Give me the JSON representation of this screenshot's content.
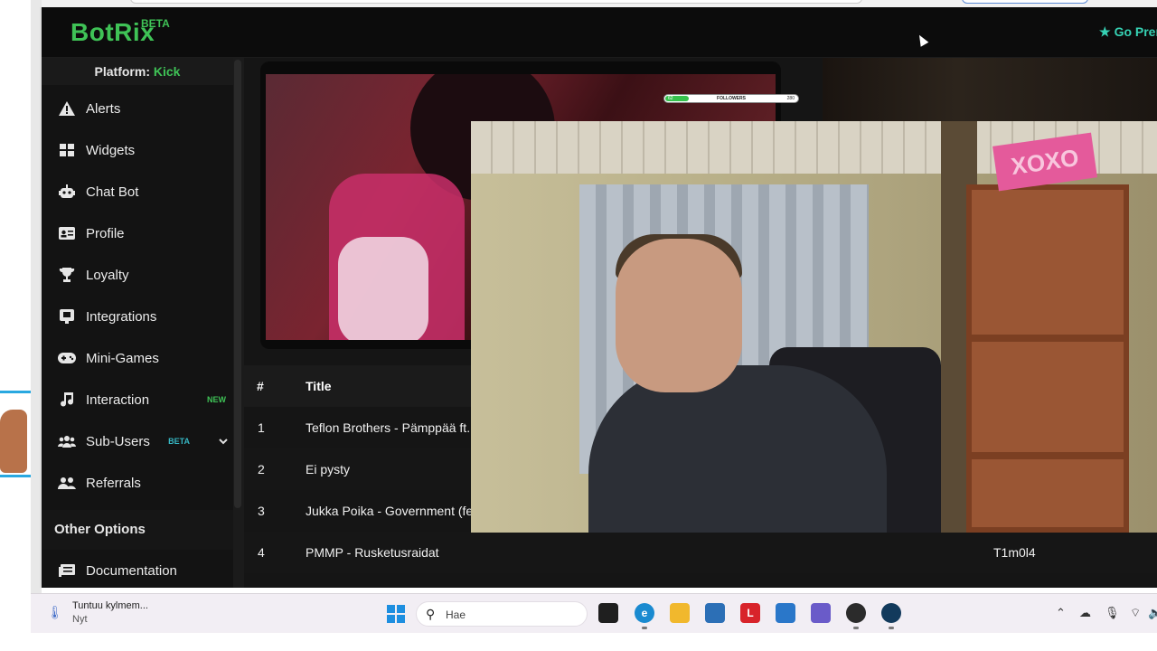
{
  "app": {
    "logo": "BotRix",
    "logo_badge": "BETA",
    "premium_label": "Go Prem"
  },
  "sidebar": {
    "platform_label": "Platform:",
    "platform_value": "Kick",
    "items": [
      {
        "label": "Alerts",
        "icon": "warning-icon"
      },
      {
        "label": "Widgets",
        "icon": "grid-icon"
      },
      {
        "label": "Chat Bot",
        "icon": "robot-icon"
      },
      {
        "label": "Profile",
        "icon": "id-card-icon"
      },
      {
        "label": "Loyalty",
        "icon": "trophy-icon"
      },
      {
        "label": "Integrations",
        "icon": "integration-icon"
      },
      {
        "label": "Mini-Games",
        "icon": "gamepad-icon"
      },
      {
        "label": "Interaction",
        "icon": "music-icon",
        "badge": "NEW"
      },
      {
        "label": "Sub-Users",
        "icon": "users-icon",
        "badge": "BETA"
      },
      {
        "label": "Referrals",
        "icon": "referral-icon"
      }
    ],
    "other_options": "Other Options",
    "documentation": "Documentation"
  },
  "preview": {
    "followers_label": "FOLLOWERS",
    "followers_current": "62",
    "followers_goal": "280",
    "followers_progress": 0.18
  },
  "table": {
    "col_num": "#",
    "col_title": "Title",
    "rows": [
      {
        "num": "1",
        "title": "Teflon Brothers - Pämppää ft.",
        "user": ""
      },
      {
        "num": "2",
        "title": "Ei pysty",
        "user": ""
      },
      {
        "num": "3",
        "title": "Jukka Poika - Government (fe",
        "user": ""
      },
      {
        "num": "4",
        "title": "PMMP - Rusketusraidat",
        "user": "T1m0l4"
      }
    ]
  },
  "cam": {
    "sign_text": "XOXO"
  },
  "taskbar": {
    "notif_title": "Tuntuu kylmem...",
    "notif_sub": "Nyt",
    "search_placeholder": "Hae",
    "apps": [
      "task-view",
      "edge",
      "file-explorer",
      "store",
      "l-app",
      "outlook",
      "teams",
      "obs",
      "steam"
    ]
  }
}
